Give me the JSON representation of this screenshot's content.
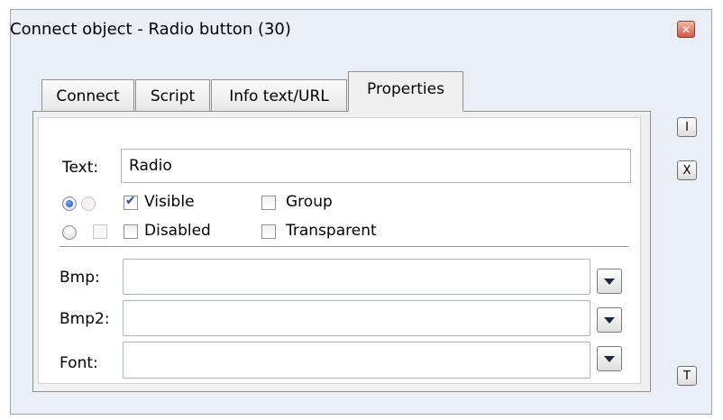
{
  "window": {
    "title": "Connect object - Radio button (30)"
  },
  "tabs": [
    {
      "label": "Connect"
    },
    {
      "label": "Script"
    },
    {
      "label": "Info text/URL"
    },
    {
      "label": "Properties"
    }
  ],
  "properties": {
    "text_label": "Text:",
    "text_value": "Radio",
    "visible_label": "Visible",
    "group_label": "Group",
    "disabled_label": "Disabled",
    "transparent_label": "Transparent",
    "bmp_label": "Bmp:",
    "bmp2_label": "Bmp2:",
    "font_label": "Font:",
    "bmp_value": "",
    "bmp2_value": "",
    "font_value": ""
  },
  "side_buttons": {
    "i": "I",
    "x": "X",
    "t": "T"
  },
  "states": {
    "radio_checked": true,
    "visible_checked": true,
    "group_checked": false,
    "disabled_checked": false,
    "transparent_checked": false
  },
  "colors": {
    "window_bg": "#e9eef7",
    "panel_bg": "#f0f0f0",
    "check_accent": "#2a4d9b"
  }
}
